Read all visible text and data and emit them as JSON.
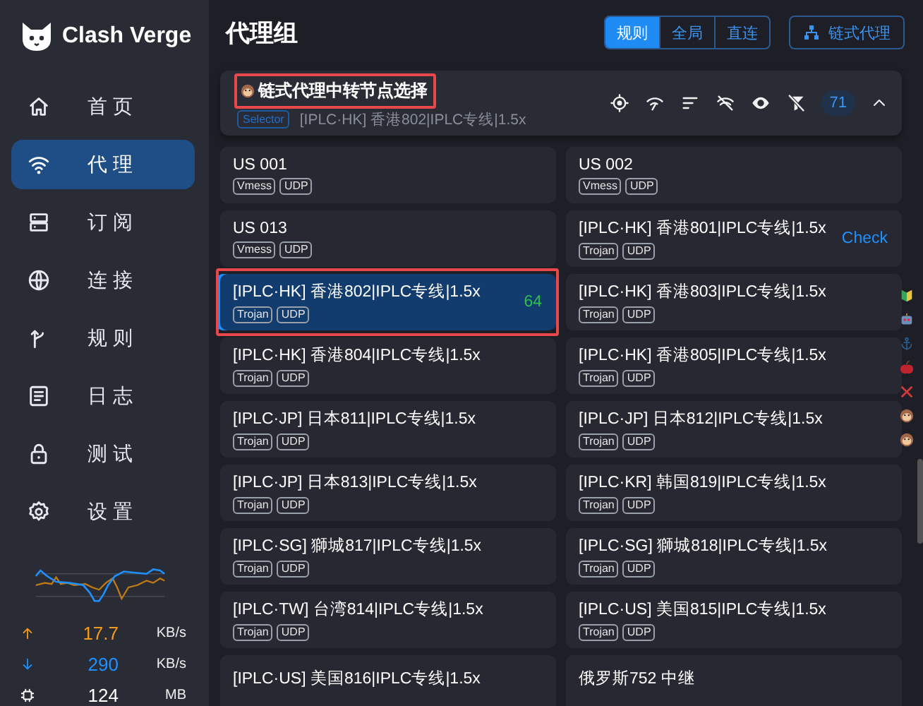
{
  "sidebar": {
    "app_name": "Clash Verge",
    "items": [
      {
        "label": "首页",
        "selected": false
      },
      {
        "label": "代理",
        "selected": true
      },
      {
        "label": "订阅",
        "selected": false
      },
      {
        "label": "连接",
        "selected": false
      },
      {
        "label": "规则",
        "selected": false
      },
      {
        "label": "日志",
        "selected": false
      },
      {
        "label": "测试",
        "selected": false
      },
      {
        "label": "设置",
        "selected": false
      }
    ]
  },
  "traffic": {
    "upload": {
      "value": "17.7",
      "unit": "KB/s"
    },
    "download": {
      "value": "290",
      "unit": "KB/s"
    },
    "memory": {
      "value": "124",
      "unit": "MB"
    }
  },
  "header": {
    "title": "代理组",
    "modes": [
      {
        "label": "规则",
        "selected": true
      },
      {
        "label": "全局",
        "selected": false
      },
      {
        "label": "直连",
        "selected": false
      }
    ],
    "chain_button": "链式代理"
  },
  "group": {
    "title": "链式代理中转节点选择",
    "highlighted": true,
    "type": "Selector",
    "current": "[IPLC·HK] 香港802|IPLC专线|1.5x",
    "count": "71",
    "expanded": true
  },
  "proxies": [
    {
      "name": "US 001",
      "tags": [
        "Vmess",
        "UDP"
      ],
      "selected": false,
      "highlighted": false
    },
    {
      "name": "US 002",
      "tags": [
        "Vmess",
        "UDP"
      ],
      "selected": false,
      "highlighted": false
    },
    {
      "name": "US 013",
      "tags": [
        "Vmess",
        "UDP"
      ],
      "selected": false,
      "highlighted": false
    },
    {
      "name": "[IPLC·HK] 香港801|IPLC专线|1.5x",
      "tags": [
        "Trojan",
        "UDP"
      ],
      "selected": false,
      "highlighted": false,
      "action": "Check"
    },
    {
      "name": "[IPLC·HK] 香港802|IPLC专线|1.5x",
      "tags": [
        "Trojan",
        "UDP"
      ],
      "selected": true,
      "highlighted": true,
      "delay": "64"
    },
    {
      "name": "[IPLC·HK] 香港803|IPLC专线|1.5x",
      "tags": [
        "Trojan",
        "UDP"
      ],
      "selected": false,
      "highlighted": false
    },
    {
      "name": "[IPLC·HK] 香港804|IPLC专线|1.5x",
      "tags": [
        "Trojan",
        "UDP"
      ],
      "selected": false,
      "highlighted": false
    },
    {
      "name": "[IPLC·HK] 香港805|IPLC专线|1.5x",
      "tags": [
        "Trojan",
        "UDP"
      ],
      "selected": false,
      "highlighted": false
    },
    {
      "name": "[IPLC·JP] 日本811|IPLC专线|1.5x",
      "tags": [
        "Trojan",
        "UDP"
      ],
      "selected": false,
      "highlighted": false
    },
    {
      "name": "[IPLC·JP] 日本812|IPLC专线|1.5x",
      "tags": [
        "Trojan",
        "UDP"
      ],
      "selected": false,
      "highlighted": false
    },
    {
      "name": "[IPLC·JP] 日本813|IPLC专线|1.5x",
      "tags": [
        "Trojan",
        "UDP"
      ],
      "selected": false,
      "highlighted": false
    },
    {
      "name": "[IPLC·KR] 韩国819|IPLC专线|1.5x",
      "tags": [
        "Trojan",
        "UDP"
      ],
      "selected": false,
      "highlighted": false
    },
    {
      "name": "[IPLC·SG] 獅城817|IPLC专线|1.5x",
      "tags": [
        "Trojan",
        "UDP"
      ],
      "selected": false,
      "highlighted": false
    },
    {
      "name": "[IPLC·SG] 獅城818|IPLC专线|1.5x",
      "tags": [
        "Trojan",
        "UDP"
      ],
      "selected": false,
      "highlighted": false
    },
    {
      "name": "[IPLC·TW] 台湾814|IPLC专线|1.5x",
      "tags": [
        "Trojan",
        "UDP"
      ],
      "selected": false,
      "highlighted": false
    },
    {
      "name": "[IPLC·US] 美国815|IPLC专线|1.5x",
      "tags": [
        "Trojan",
        "UDP"
      ],
      "selected": false,
      "highlighted": false
    },
    {
      "name": "[IPLC·US] 美国816|IPLC专线|1.5x",
      "selected": false,
      "highlighted": false
    },
    {
      "name": "俄罗斯752 中继",
      "selected": false,
      "highlighted": false
    }
  ]
}
